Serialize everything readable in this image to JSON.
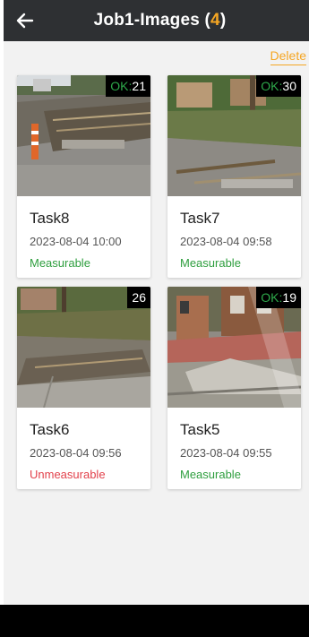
{
  "header": {
    "title": "Job1-Images",
    "count_open": "(",
    "count": "4",
    "count_close": ")"
  },
  "actions": {
    "delete_label": "Delete"
  },
  "tasks": [
    {
      "name": "Task8",
      "date": "2023-08-04 10:00",
      "status": "Measurable",
      "badge_ok": "OK:",
      "badge_value": "21"
    },
    {
      "name": "Task7",
      "date": "2023-08-04 09:58",
      "status": "Measurable",
      "badge_ok": "OK:",
      "badge_value": "30"
    },
    {
      "name": "Task6",
      "date": "2023-08-04 09:56",
      "status": "Unmeasurable",
      "badge_ok": "",
      "badge_value": "26"
    },
    {
      "name": "Task5",
      "date": "2023-08-04 09:55",
      "status": "Measurable",
      "badge_ok": "OK:",
      "badge_value": "19"
    }
  ],
  "colors": {
    "header_bg": "#2e3033",
    "accent": "#f5a623",
    "measurable": "#2e9e3e",
    "unmeasurable": "#e2414b",
    "ok_badge": "#2ea84a"
  },
  "icons": {
    "back": "arrow-left-icon"
  }
}
